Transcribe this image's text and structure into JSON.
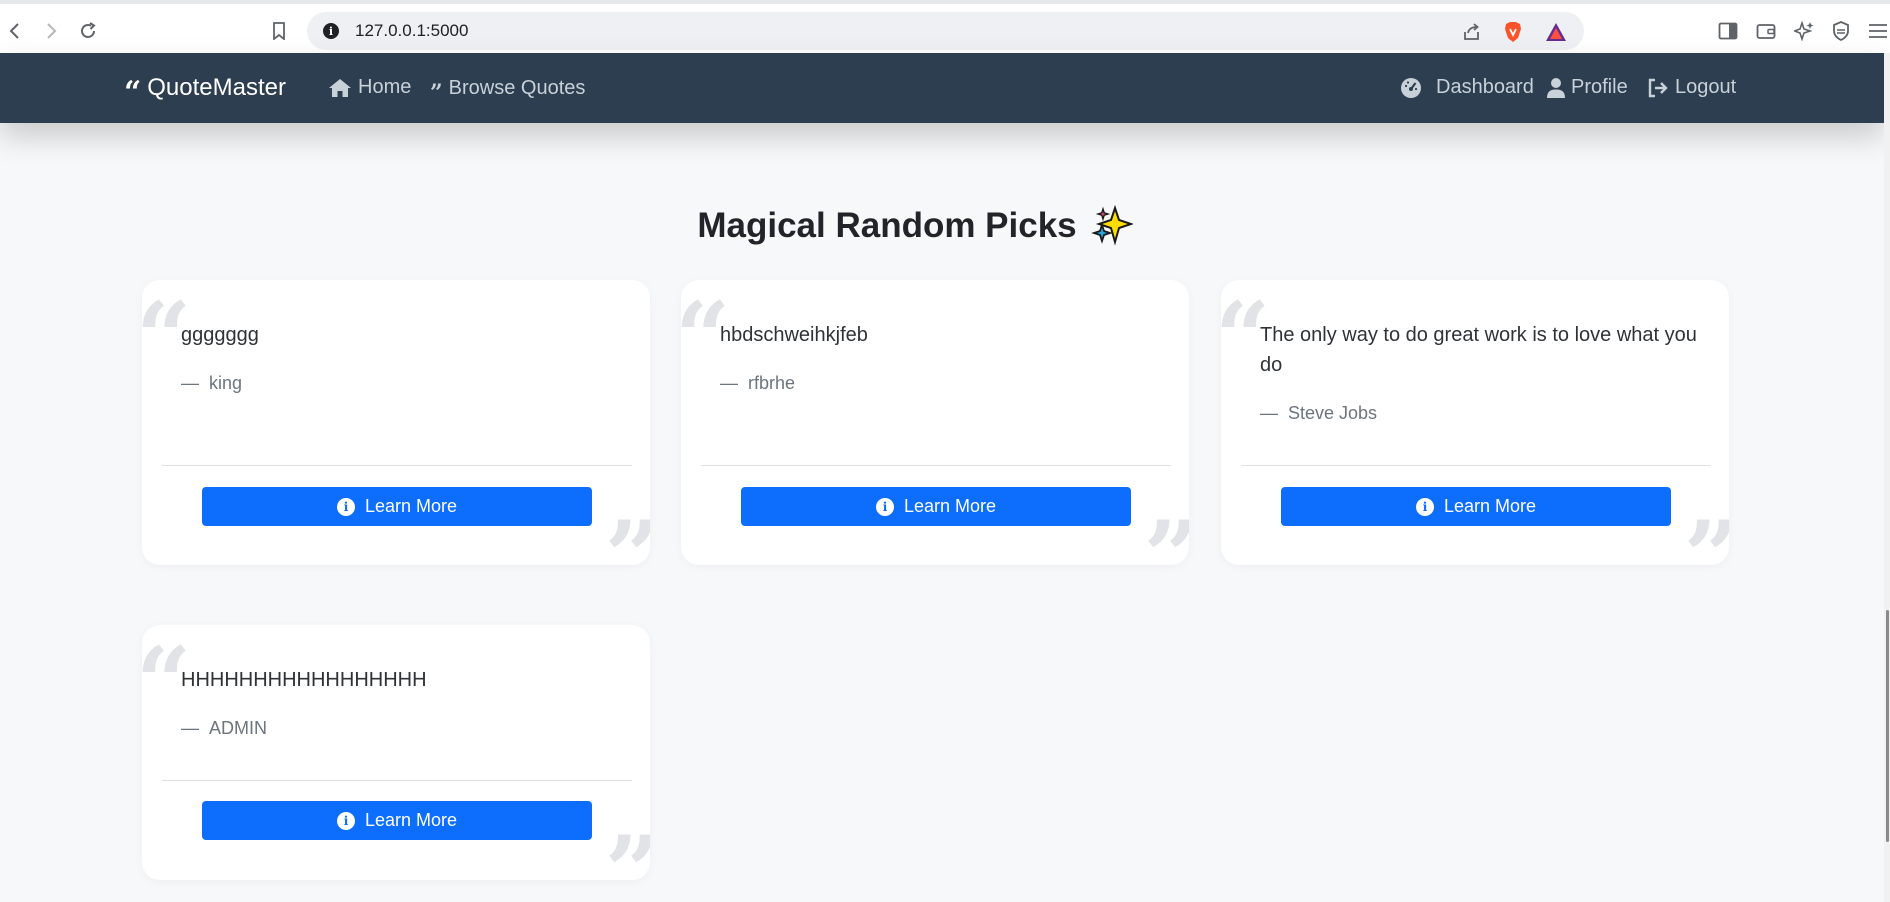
{
  "browser": {
    "url": "127.0.0.1:5000"
  },
  "navbar": {
    "brand": "QuoteMaster",
    "links_left": [
      {
        "label": "Home",
        "icon": "home-icon"
      },
      {
        "label": "Browse Quotes",
        "icon": "quote-icon"
      }
    ],
    "links_right": [
      {
        "label": "Dashboard",
        "icon": "dashboard-icon"
      },
      {
        "label": "Profile",
        "icon": "user-icon"
      },
      {
        "label": "Logout",
        "icon": "logout-icon"
      }
    ],
    "background_color": "#2c3e50"
  },
  "section": {
    "title": "Magical Random Picks"
  },
  "cards": [
    {
      "quote": "ggggggg",
      "author": "king",
      "button": "Learn More"
    },
    {
      "quote": "hbdschweihkjfeb",
      "author": "rfbrhe",
      "button": "Learn More"
    },
    {
      "quote": "The only way to do great work is to love what you do",
      "author": "Steve Jobs",
      "button": "Learn More"
    },
    {
      "quote": "HHHHHHHHHHHHHHHHH",
      "author": "ADMIN",
      "button": "Learn More"
    }
  ],
  "colors": {
    "accent": "#0d6efd",
    "page_bg": "#f7f8fa"
  }
}
